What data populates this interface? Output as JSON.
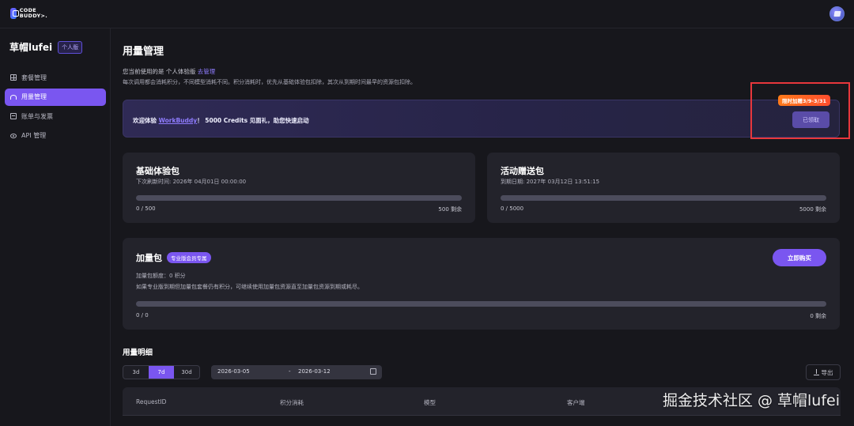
{
  "logo": {
    "line1": "CODE",
    "line2": "BUDDY>."
  },
  "sidebar": {
    "user_name": "草帽lufei",
    "plan_badge": "个人版",
    "items": [
      {
        "label": "套餐管理",
        "icon": "grid-icon"
      },
      {
        "label": "用量管理",
        "icon": "gauge-icon",
        "active": true
      },
      {
        "label": "账单与发票",
        "icon": "bill-icon"
      },
      {
        "label": "API 管理",
        "icon": "eye-icon"
      }
    ]
  },
  "page": {
    "title": "用量管理",
    "intro_prefix": "您当前使用的是 个人体验版 ",
    "intro_link": "去管理",
    "intro_rule": "每次调用都会消耗积分，不同模型消耗不同。积分消耗时，优先从基础体验包扣除，其次从到期时间最早的资源包扣除。"
  },
  "promo": {
    "text_before": "欢迎体验 ",
    "link": "WorkBuddy",
    "text_after": "！ 5000 Credits 见面礼，助您快速启动",
    "tag": "限时加赠3/9-3/31",
    "button": "已领取"
  },
  "base_pack": {
    "title": "基础体验包",
    "sub": "下次刷新时间: 2026年 04月01日 00:00:00",
    "used_text": "0 / 500",
    "remain_text": "500 剩余",
    "used_fraction": 0
  },
  "event_pack": {
    "title": "活动赠送包",
    "sub": "到期日期:    2027年 03月12日 13:51:15",
    "used_text": "0 / 5000",
    "remain_text": "5000 剩余",
    "used_fraction": 0
  },
  "addon_pack": {
    "title": "加量包",
    "badge": "专业版会员专属",
    "buy_button": "立即购买",
    "quota": "加量包额度：0 积分",
    "note": "如果专业版到期但加量包套餐仍有积分，可继续使用加量包资源直至加量包资源到期或耗尽。",
    "used_text": "0 / 0",
    "remain_text": "0 剩余",
    "used_fraction": 0
  },
  "usage_detail": {
    "title": "用量明细",
    "ranges": [
      "3d",
      "7d",
      "30d"
    ],
    "active_range": "7d",
    "date_start": "2026-03-05",
    "date_sep": "-",
    "date_end": "2026-03-12",
    "export": "导出",
    "columns": [
      "RequestID",
      "积分消耗",
      "模型",
      "客户端"
    ]
  },
  "watermark": "掘金技术社区 @ 草帽lufei",
  "colors": {
    "accent": "#7a56f0",
    "highlight_box": "#e8373c",
    "tag_orange": "#ff6a22"
  }
}
